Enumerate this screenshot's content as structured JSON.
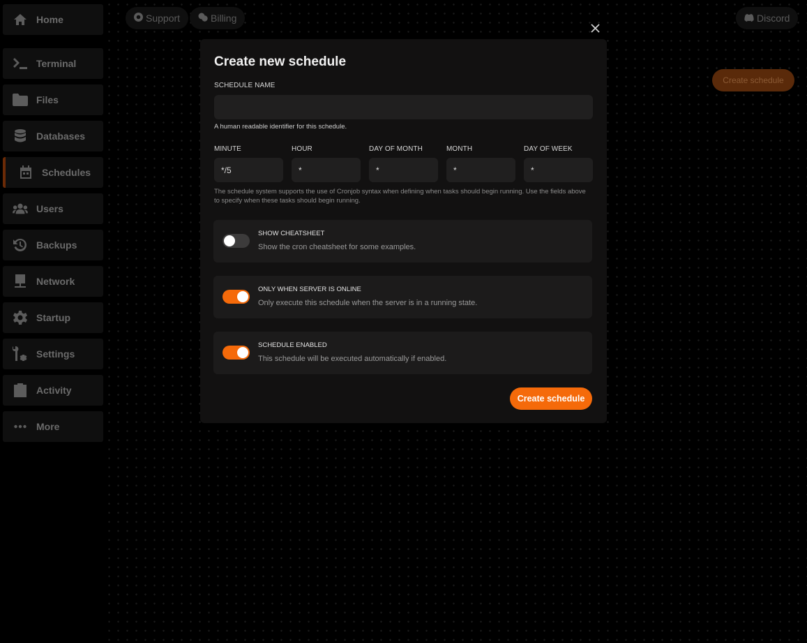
{
  "sidebar": {
    "items": [
      {
        "label": "Home",
        "icon": "home-icon"
      },
      {
        "label": "Terminal",
        "icon": "terminal-icon"
      },
      {
        "label": "Files",
        "icon": "folder-icon"
      },
      {
        "label": "Databases",
        "icon": "database-icon"
      },
      {
        "label": "Schedules",
        "icon": "calendar-icon",
        "active": true
      },
      {
        "label": "Users",
        "icon": "users-icon"
      },
      {
        "label": "Backups",
        "icon": "backup-icon"
      },
      {
        "label": "Network",
        "icon": "network-icon"
      },
      {
        "label": "Startup",
        "icon": "gear-icon"
      },
      {
        "label": "Settings",
        "icon": "settings-icon"
      },
      {
        "label": "Activity",
        "icon": "activity-icon"
      },
      {
        "label": "More",
        "icon": "more-icon"
      }
    ]
  },
  "topbar": {
    "support": "Support",
    "billing": "Billing",
    "discord": "Discord"
  },
  "page": {
    "create_button": "Create schedule"
  },
  "modal": {
    "title": "Create new schedule",
    "name_label": "SCHEDULE NAME",
    "name_value": "",
    "name_help": "A human readable identifier for this schedule.",
    "cron": [
      {
        "label": "MINUTE",
        "value": "*/5"
      },
      {
        "label": "HOUR",
        "value": "*"
      },
      {
        "label": "DAY OF MONTH",
        "value": "*"
      },
      {
        "label": "MONTH",
        "value": "*"
      },
      {
        "label": "DAY OF WEEK",
        "value": "*"
      }
    ],
    "cron_help": "The schedule system supports the use of Cronjob syntax when defining when tasks should begin running. Use the fields above to specify when these tasks should begin running.",
    "options": [
      {
        "title": "SHOW CHEATSHEET",
        "desc": "Show the cron cheatsheet for some examples.",
        "on": false
      },
      {
        "title": "ONLY WHEN SERVER IS ONLINE",
        "desc": "Only execute this schedule when the server is in a running state.",
        "on": true
      },
      {
        "title": "SCHEDULE ENABLED",
        "desc": "This schedule will be executed automatically if enabled.",
        "on": true
      }
    ],
    "submit": "Create schedule"
  },
  "colors": {
    "accent": "#f56a0a",
    "modal_bg": "#121111",
    "input_bg": "#201f1f"
  }
}
